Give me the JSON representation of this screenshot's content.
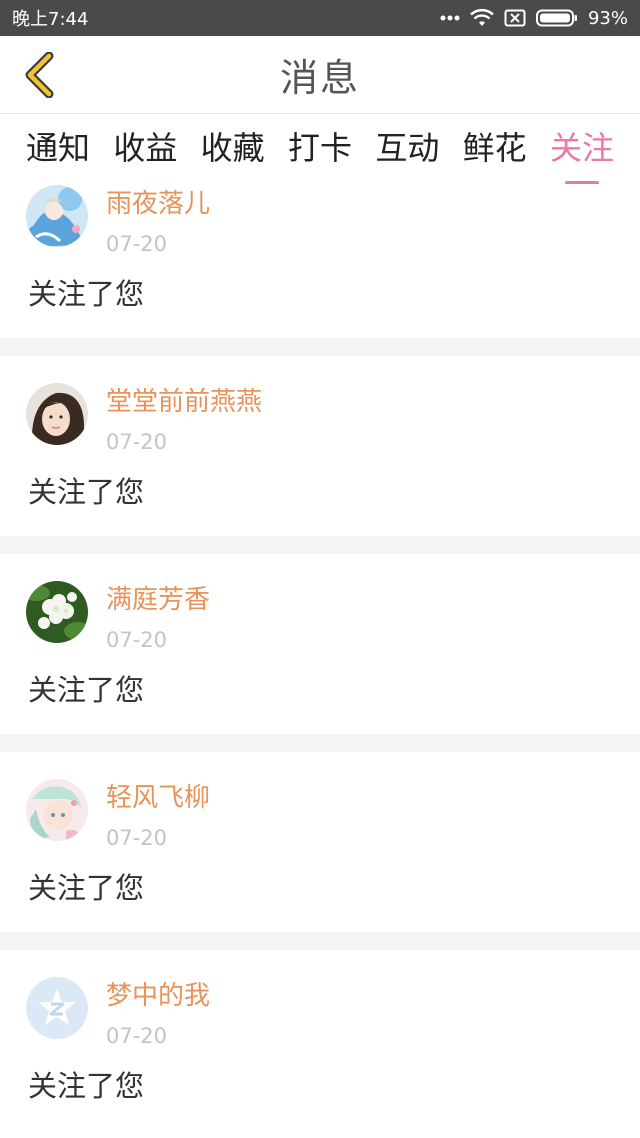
{
  "status_bar": {
    "time": "晚上7:44",
    "battery": "93%"
  },
  "header": {
    "title": "消息",
    "back_icon": "chevron-left-icon",
    "accent_color": "#f2c530"
  },
  "tabs": [
    {
      "label": "通知",
      "active": false
    },
    {
      "label": "收益",
      "active": false
    },
    {
      "label": "收藏",
      "active": false
    },
    {
      "label": "打卡",
      "active": false
    },
    {
      "label": "互动",
      "active": false
    },
    {
      "label": "鲜花",
      "active": false
    },
    {
      "label": "关注",
      "active": true
    }
  ],
  "colors": {
    "active_tab": "#ee78a5",
    "username": "#e8935a",
    "date": "#c4c4c4"
  },
  "messages": [
    {
      "name": "雨夜落儿",
      "date": "07-20",
      "text": "关注了您",
      "avatar": "anime-girl-blue-avatar"
    },
    {
      "name": "堂堂前前燕燕",
      "date": "07-20",
      "text": "关注了您",
      "avatar": "woman-photo-avatar"
    },
    {
      "name": "满庭芳香",
      "date": "07-20",
      "text": "关注了您",
      "avatar": "white-flowers-avatar"
    },
    {
      "name": "轻风飞柳",
      "date": "07-20",
      "text": "关注了您",
      "avatar": "anime-girl-pastel-avatar"
    },
    {
      "name": "梦中的我",
      "date": "07-20",
      "text": "关注了您",
      "avatar": "default-star-avatar"
    }
  ]
}
